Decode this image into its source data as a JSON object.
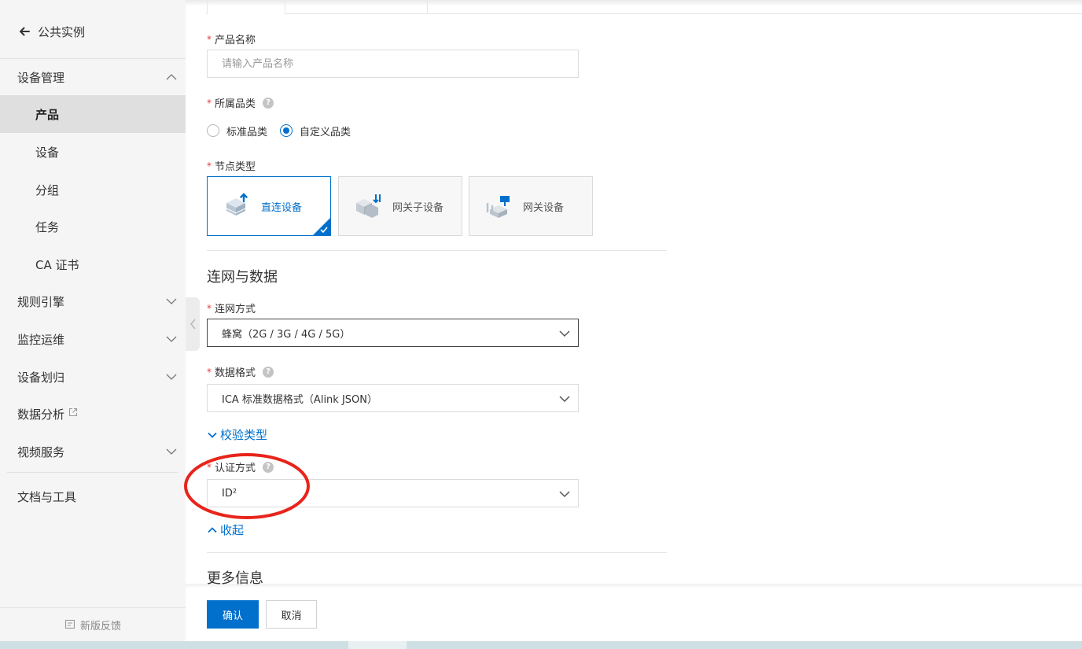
{
  "sidebar": {
    "back_label": "公共实例",
    "groups": [
      {
        "label": "设备管理",
        "expanded": true
      },
      {
        "label": "规则引擎"
      },
      {
        "label": "监控运维"
      },
      {
        "label": "设备划归"
      },
      {
        "label": "数据分析"
      },
      {
        "label": "视频服务"
      },
      {
        "label": "文档与工具"
      }
    ],
    "sub_items": [
      {
        "label": "产品",
        "active": true
      },
      {
        "label": "设备"
      },
      {
        "label": "分组"
      },
      {
        "label": "任务"
      },
      {
        "label": "CA 证书"
      }
    ],
    "feedback_label": "新版反馈"
  },
  "form": {
    "product_name": {
      "label": "产品名称",
      "placeholder": "请输入产品名称",
      "value": ""
    },
    "category": {
      "label": "所属品类",
      "options": [
        "标准品类",
        "自定义品类"
      ],
      "selected": "自定义品类"
    },
    "node_type": {
      "label": "节点类型",
      "options": [
        "直连设备",
        "网关子设备",
        "网关设备"
      ],
      "selected": "直连设备"
    },
    "network_section_title": "连网与数据",
    "network_mode": {
      "label": "连网方式",
      "value": "蜂窝（2G / 3G / 4G / 5G）"
    },
    "data_format": {
      "label": "数据格式",
      "value": "ICA 标准数据格式（Alink JSON）"
    },
    "verify_toggle": "校验类型",
    "auth_method": {
      "label": "认证方式",
      "value": "ID²"
    },
    "collapse_toggle": "收起",
    "more_info_title": "更多信息"
  },
  "footer": {
    "confirm_label": "确认",
    "cancel_label": "取消"
  },
  "colors": {
    "accent": "#0070cc",
    "required": "#e4393c",
    "brand_orange": "#ff6a00",
    "annotation": "#e8241b"
  }
}
